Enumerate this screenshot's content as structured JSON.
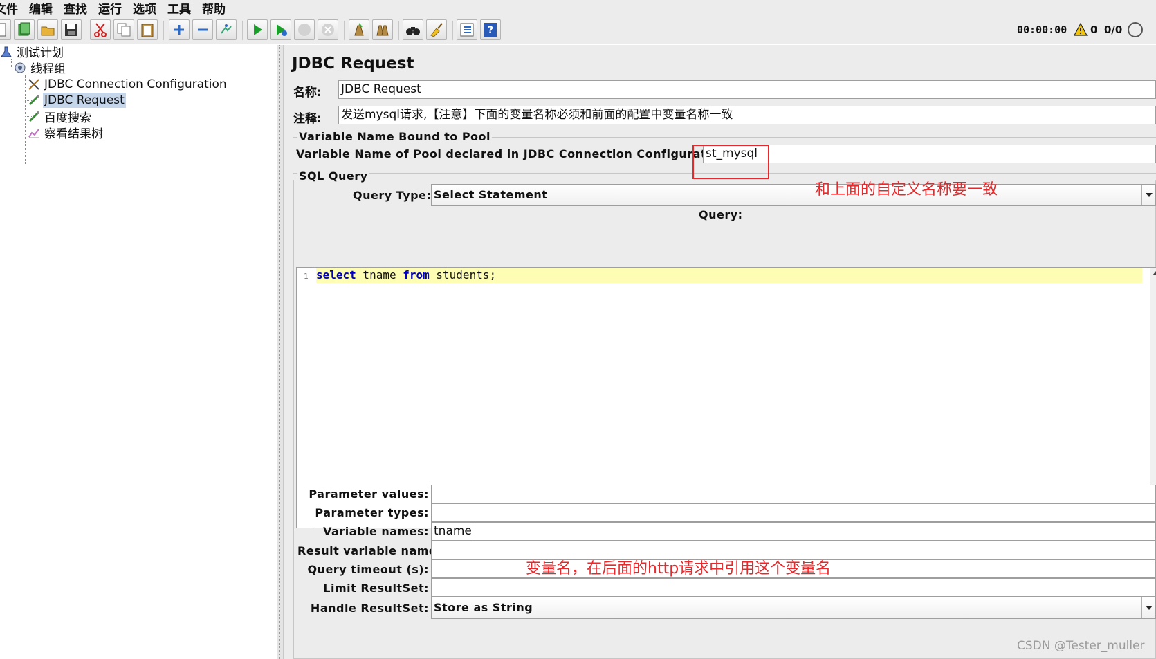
{
  "menubar": {
    "items": [
      "文件",
      "编辑",
      "查找",
      "运行",
      "选项",
      "工具",
      "帮助"
    ]
  },
  "toolbar": {
    "buttons": [
      "new-icon",
      "templates-icon",
      "open-icon",
      "save-icon",
      "cut-icon",
      "copy-icon",
      "paste-icon",
      "expand-icon",
      "collapse-icon",
      "toggle-icon",
      "start-icon",
      "start-no-pauses-icon",
      "stop-icon",
      "shutdown-icon",
      "clear-icon",
      "clear-all-icon",
      "search-icon",
      "reset-search-icon",
      "function-helper-icon",
      "help-icon"
    ],
    "timer": "00:00:00",
    "warning_count": "0",
    "thread_count": "0/0"
  },
  "tree": {
    "items": [
      {
        "label": "测试计划",
        "icon": "test-plan-icon"
      },
      {
        "label": "线程组",
        "icon": "thread-group-icon"
      },
      {
        "label": "JDBC Connection Configuration",
        "icon": "config-element-icon"
      },
      {
        "label": "JDBC Request",
        "icon": "sampler-icon",
        "selected": true
      },
      {
        "label": "百度搜索",
        "icon": "sampler-icon"
      },
      {
        "label": "察看结果树",
        "icon": "listener-icon"
      }
    ]
  },
  "panel": {
    "title": "JDBC Request",
    "name_label": "名称:",
    "name_value": "JDBC Request",
    "comment_label": "注释:",
    "comment_value": "发送mysql请求,【注意】下面的变量名称必须和前面的配置中变量名称一致",
    "pool_group_title": "Variable Name Bound to Pool",
    "pool_label": "Variable Name of Pool declared in JDBC Connection Configuration:",
    "pool_value": "st_mysql",
    "sql_group_title": "SQL Query",
    "query_type_label": "Query Type:",
    "query_type_value": "Select Statement",
    "query_label": "Query:",
    "query_line_number": "1",
    "query_code": {
      "kw1": "select",
      "t1": " tname ",
      "kw2": "from",
      "t2": " students;"
    },
    "params": [
      {
        "label": "Parameter values:",
        "value": ""
      },
      {
        "label": "Parameter types:",
        "value": ""
      },
      {
        "label": "Variable names:",
        "value": "tname"
      },
      {
        "label": "Result variable name:",
        "value": ""
      },
      {
        "label": "Query timeout (s):",
        "value": ""
      },
      {
        "label": "Limit ResultSet:",
        "value": ""
      }
    ],
    "handle_resultset_label": "Handle ResultSet:",
    "handle_resultset_value": "Store as String"
  },
  "annotations": {
    "pool_note": "和上面的自定义名称要一致",
    "variable_note": "变量名，在后面的http请求中引用这个变量名",
    "highlight_color": "#e8282a"
  },
  "watermark": "CSDN @Tester_muller"
}
